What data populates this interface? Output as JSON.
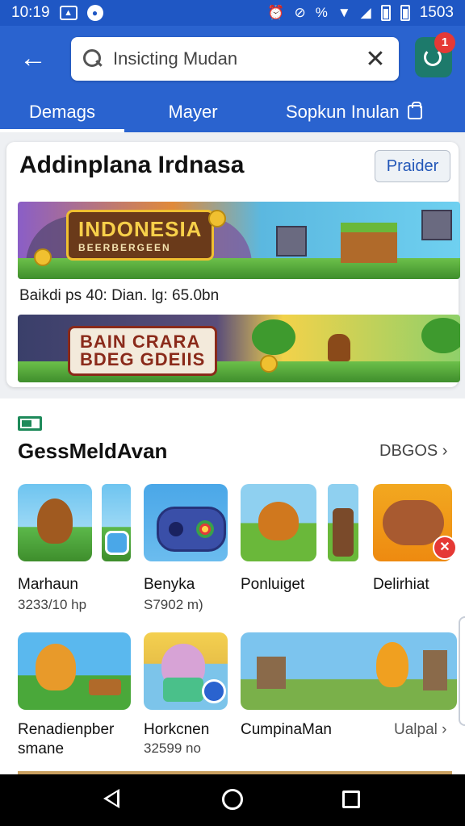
{
  "status_bar": {
    "time": "10:19",
    "battery_text": "1503"
  },
  "header": {
    "search": {
      "value": "Insicting Mudan",
      "placeholder": ""
    },
    "notification_count": "1",
    "tabs": [
      {
        "label": "Demags",
        "active": true
      },
      {
        "label": "Mayer",
        "active": false
      },
      {
        "label": "Sopkun Inulan",
        "active": false
      }
    ]
  },
  "featured": {
    "title": "Addinplana Irdnasa",
    "action_label": "Praider",
    "banner1_logo": "INDONESIA",
    "banner1_logo_sub": "BEERBERGEEN",
    "caption": "Baikdi ps 40: Dian. lg: 65.0bn",
    "banner2_logo_line1": "BAIN CRARA",
    "banner2_logo_line2": "BDEG GDEIIS"
  },
  "games_section": {
    "heading": "GessMeldAvan",
    "see_all_label": "DBGOS ›",
    "rows": [
      [
        {
          "name": "Marhaun",
          "meta": "3233/10 hp"
        },
        {
          "name": "Benyka",
          "meta": "S7902 m)"
        },
        {
          "name": "Ponluiget",
          "meta": ""
        },
        {
          "name": "Delirhiat",
          "meta": ""
        }
      ],
      [
        {
          "name": "Renadienpber",
          "name2": "smane"
        },
        {
          "name": "Horkcnen",
          "meta": "32599 no"
        },
        {
          "name": "CumpinaMan",
          "meta": ""
        },
        {
          "name": "Ualpal ›",
          "meta": ""
        }
      ]
    ]
  },
  "colors": {
    "appbar": "#2a63cf",
    "status_bar": "#1f57c4",
    "accent_green": "#1e8a5a",
    "badge_red": "#e53935"
  },
  "icons": [
    "back-arrow-icon",
    "search-icon",
    "clear-icon",
    "notification-icon",
    "bag-icon",
    "flag-icon",
    "chevron-right-icon",
    "nav-back-icon",
    "nav-home-icon",
    "nav-recents-icon"
  ]
}
